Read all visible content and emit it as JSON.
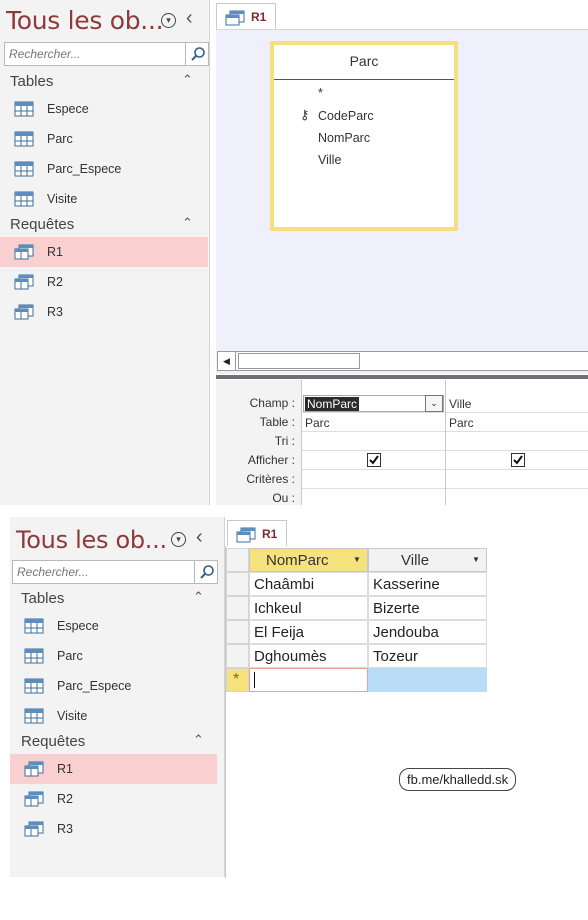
{
  "nav": {
    "title": "Tous les ob...",
    "search_placeholder": "Rechercher...",
    "groups": [
      {
        "label": "Tables",
        "items": [
          "Espece",
          "Parc",
          "Parc_Espece",
          "Visite"
        ]
      },
      {
        "label": "Requêtes",
        "items": [
          "R1",
          "R2",
          "R3"
        ]
      }
    ],
    "selected_item": "R1"
  },
  "tab": {
    "label": "R1"
  },
  "design": {
    "table": {
      "title": "Parc",
      "fields": [
        "*",
        "CodeParc",
        "NomParc",
        "Ville"
      ],
      "primary_key": "CodeParc"
    },
    "row_labels": [
      "Champ :",
      "Table :",
      "Tri :",
      "Afficher :",
      "Critères :",
      "Ou :"
    ],
    "columns": [
      {
        "champ": "NomParc",
        "table": "Parc",
        "afficher": true
      },
      {
        "champ": "Ville",
        "table": "Parc",
        "afficher": true
      }
    ]
  },
  "datasheet": {
    "headers": [
      "NomParc",
      "Ville"
    ],
    "rows": [
      [
        "Chaâmbi",
        "Kasserine"
      ],
      [
        "Ichkeul",
        "Bizerte"
      ],
      [
        "El Feija",
        "Jendouba"
      ],
      [
        "Dghoumès",
        "Tozeur"
      ]
    ],
    "new_row_marker": "*"
  },
  "watermark": "fb.me/khalledd.sk",
  "colors": {
    "accent": "#8e3a3a",
    "selected": "#f9cfd0",
    "header_highlight": "#f6e27c",
    "new_row_blue": "#b8dcf5",
    "design_background": "#eff0fb"
  }
}
